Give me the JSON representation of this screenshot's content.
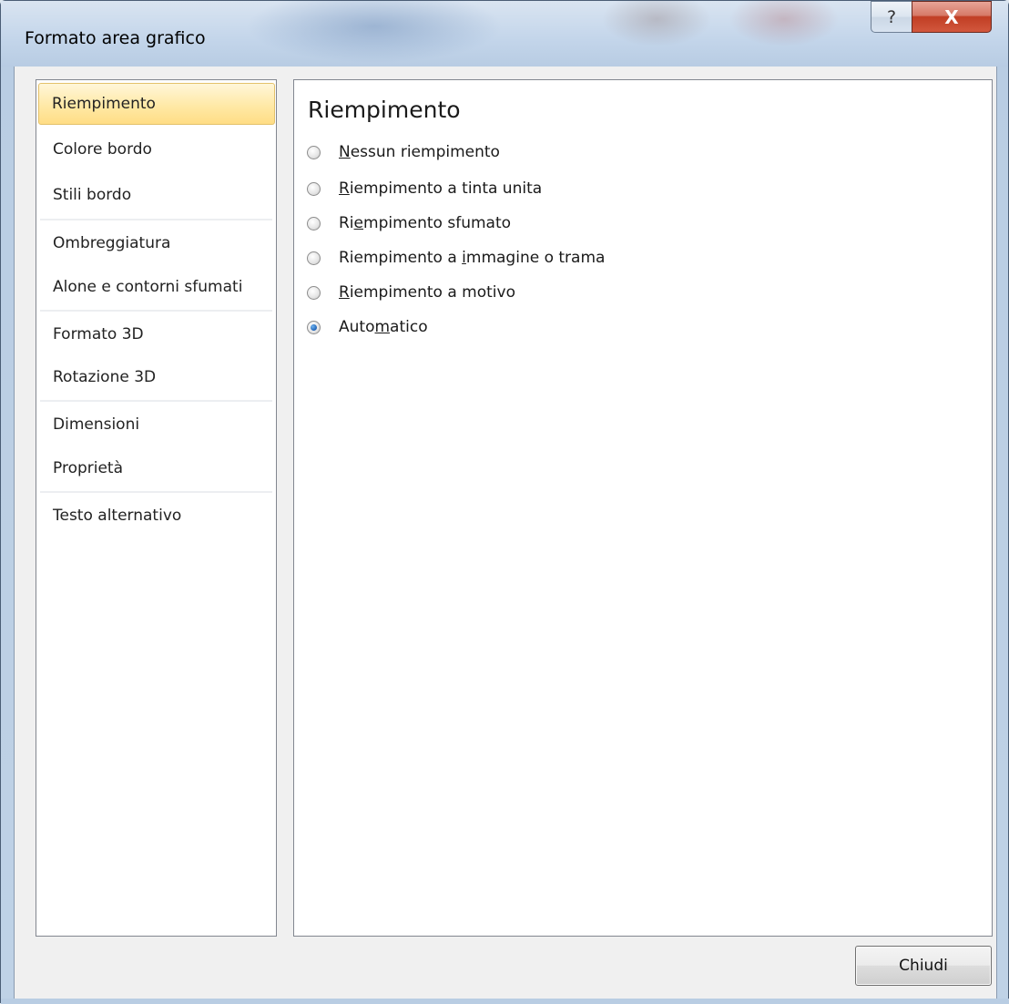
{
  "window": {
    "title": "Formato area grafico",
    "help_glyph": "?",
    "close_glyph": "X"
  },
  "sidebar": {
    "items": [
      {
        "label": "Riempimento",
        "selected": true
      },
      {
        "label": "Colore bordo",
        "selected": false
      },
      {
        "label": "Stili bordo",
        "selected": false
      },
      {
        "label": "Ombreggiatura",
        "selected": false
      },
      {
        "label": "Alone e contorni sfumati",
        "selected": false
      },
      {
        "label": "Formato 3D",
        "selected": false
      },
      {
        "label": "Rotazione 3D",
        "selected": false
      },
      {
        "label": "Dimensioni",
        "selected": false
      },
      {
        "label": "Proprietà",
        "selected": false
      },
      {
        "label": "Testo alternativo",
        "selected": false
      }
    ]
  },
  "panel": {
    "title": "Riempimento",
    "options": [
      {
        "label": "Nessun riempimento",
        "accel_index": 0,
        "checked": false
      },
      {
        "label": "Riempimento a tinta unita",
        "accel_index": 0,
        "checked": false
      },
      {
        "label": "Riempimento sfumato",
        "accel_index": 2,
        "checked": false
      },
      {
        "label": "Riempimento a immagine o trama",
        "accel_index": 14,
        "checked": false
      },
      {
        "label": "Riempimento a motivo",
        "accel_index": 0,
        "checked": false
      },
      {
        "label": "Automatico",
        "accel_index": 4,
        "checked": true
      }
    ]
  },
  "footer": {
    "close_label": "Chiudi"
  },
  "colors": {
    "selection_fill": "#ffe9a6",
    "selection_border": "#e3c16b",
    "close_red": "#c13e24"
  }
}
